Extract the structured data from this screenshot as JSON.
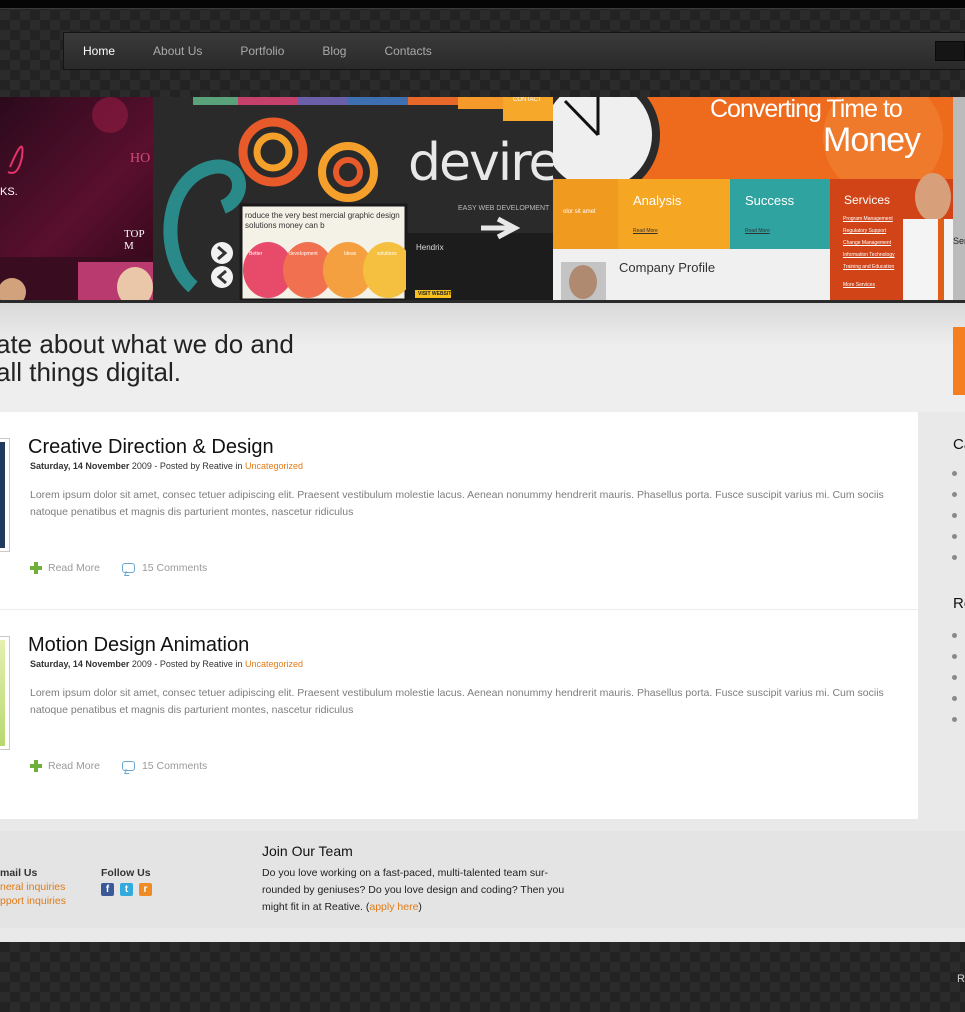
{
  "nav": {
    "items": [
      "Home",
      "About Us",
      "Portfolio",
      "Blog",
      "Contacts"
    ]
  },
  "slider": {
    "left": {
      "text1": "HO",
      "text2": "KS.",
      "text3": "TOP M"
    },
    "center": {
      "brand": "devire",
      "tagline": "EASY WEB DEVELOPMENT",
      "card_text": "roduce the very best mercial graphic design solutions money can b",
      "bubble_labels": [
        "Better",
        "development",
        "Ideas",
        "solutions"
      ],
      "panel_name": "Hendrix",
      "panel_button": "VISIT WEBSITE",
      "top_label": "CONTACT"
    },
    "right": {
      "headline1": "Converting Time to",
      "headline2": "Money",
      "col_analysis": "Analysis",
      "col_success": "Success",
      "col_services": "Services",
      "company_profile": "Company Profile",
      "read_more": "Read More",
      "side_text": "olor sit amet",
      "services_list": [
        "Program Management",
        "Regulatory Support",
        "Change Management",
        "Information Technology",
        "Training and Education"
      ],
      "more_services": "More Services",
      "edge_text": "Ser"
    }
  },
  "tagline": {
    "line1": "ate about what we do and",
    "line2": "all things digital."
  },
  "posts": [
    {
      "title": "Creative Direction & Design",
      "date": "Saturday, 14 November",
      "year_by": " 2009 - Posted by Reative in ",
      "category": "Uncategorized",
      "body": "Lorem ipsum dolor sit amet, consec tetuer adipiscing elit. Praesent vestibulum molestie lacus. Aenean nonummy hendrerit mauris. Phasellus porta. Fusce suscipit varius mi. Cum sociis natoque penatibus et magnis dis parturient montes, nascetur ridiculus",
      "read_more": "Read More",
      "comments": "15 Comments",
      "thumb_color": "#1f3a5a"
    },
    {
      "title": "Motion Design Animation",
      "date": "Saturday, 14 November",
      "year_by": " 2009 - Posted by Reative in ",
      "category": "Uncategorized",
      "body": "Lorem ipsum dolor sit amet, consec tetuer adipiscing elit. Praesent vestibulum molestie lacus. Aenean nonummy hendrerit mauris. Phasellus porta. Fusce suscipit varius mi. Cum sociis natoque penatibus et magnis dis parturient montes, nascetur ridiculus",
      "read_more": "Read More",
      "comments": "15 Comments",
      "thumb_color": "#c9e08a"
    }
  ],
  "sidebar": {
    "title1": "Ca",
    "title2": "Re"
  },
  "footer": {
    "email_title": "mail Us",
    "email_links": [
      "neral inquiries",
      "pport inquiries"
    ],
    "follow_title": "Follow Us",
    "social": {
      "facebook": "f",
      "twitter": "t",
      "rss": "r"
    },
    "join_title": "Join Our Team",
    "join_text": "Do you love working on a fast-paced, multi-talented team sur-rounded by geniuses? Do you love design and coding? Then you might fit in at Reative. (",
    "join_link": "apply here",
    "join_close": ")"
  },
  "bottom": {
    "text": "R"
  },
  "colors": {
    "accent": "#f57f20",
    "link": "#e07b18"
  }
}
